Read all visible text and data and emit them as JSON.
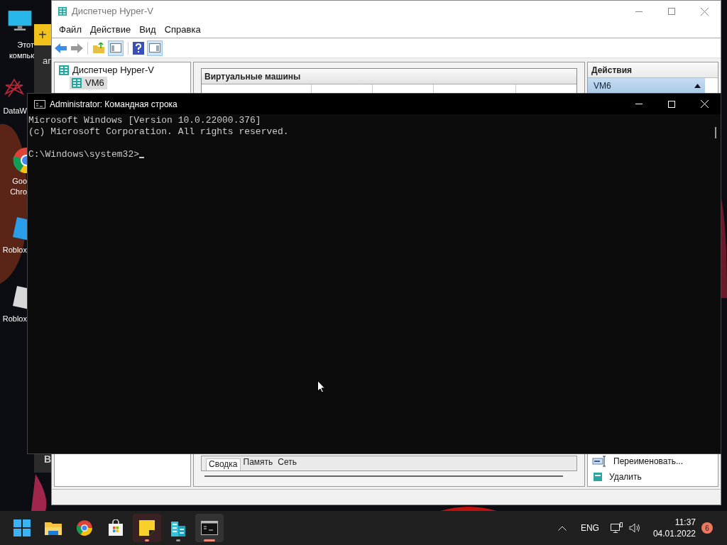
{
  "desktop": {
    "icons": [
      {
        "kind": "computer",
        "lines": [
          "Этот",
          "компьк"
        ]
      },
      {
        "kind": "data",
        "lines": [
          "DataW"
        ]
      },
      {
        "kind": "chrome",
        "lines": [
          "Goo",
          "Chro"
        ]
      },
      {
        "kind": "roblox-studio",
        "lines": [
          "Roblox"
        ]
      },
      {
        "kind": "roblox",
        "lines": [
          "Roblox"
        ]
      }
    ]
  },
  "sticky_note": {
    "button": "+",
    "texts": [
      "ar",
      "B"
    ]
  },
  "hyperv": {
    "title": "Диспетчер Hyper-V",
    "menu": [
      "Файл",
      "Действие",
      "Вид",
      "Справка"
    ],
    "tree": [
      {
        "label": "Диспетчер Hyper-V",
        "selected": false,
        "children": [
          {
            "label": "VM6",
            "selected": true
          }
        ]
      }
    ],
    "vm_panel": {
      "title": "Виртуальные машины"
    },
    "details_tabs": [
      {
        "label": "Сводка",
        "selected": true
      },
      {
        "label": "Память",
        "selected": false
      },
      {
        "label": "Сеть",
        "selected": false
      }
    ],
    "actions": {
      "title": "Действия",
      "group": "VM6",
      "items": [
        {
          "kind": "rename",
          "label": "Переименовать..."
        },
        {
          "kind": "delete",
          "label": "Удалить"
        }
      ]
    }
  },
  "cmd": {
    "title": "Administrator: Командная строка",
    "output": [
      "Microsoft Windows [Version 10.0.22000.376]",
      "(c) Microsoft Corporation. All rights reserved."
    ],
    "prompt": "C:\\Windows\\system32>"
  },
  "taskbar": {
    "apps": [
      {
        "kind": "start",
        "running": false,
        "active": false,
        "attention": false
      },
      {
        "kind": "explorer",
        "running": false,
        "active": false,
        "attention": false
      },
      {
        "kind": "chrome",
        "running": false,
        "active": false,
        "attention": false
      },
      {
        "kind": "store",
        "running": false,
        "active": false,
        "attention": false
      },
      {
        "kind": "sticky",
        "running": true,
        "active": false,
        "attention": true
      },
      {
        "kind": "hyperv",
        "running": true,
        "active": false,
        "attention": false
      },
      {
        "kind": "terminal",
        "running": true,
        "active": true,
        "attention": false
      }
    ],
    "tray": {
      "language": "ENG",
      "time": "11:37",
      "date": "04.01.2022",
      "notifications": "6"
    }
  }
}
